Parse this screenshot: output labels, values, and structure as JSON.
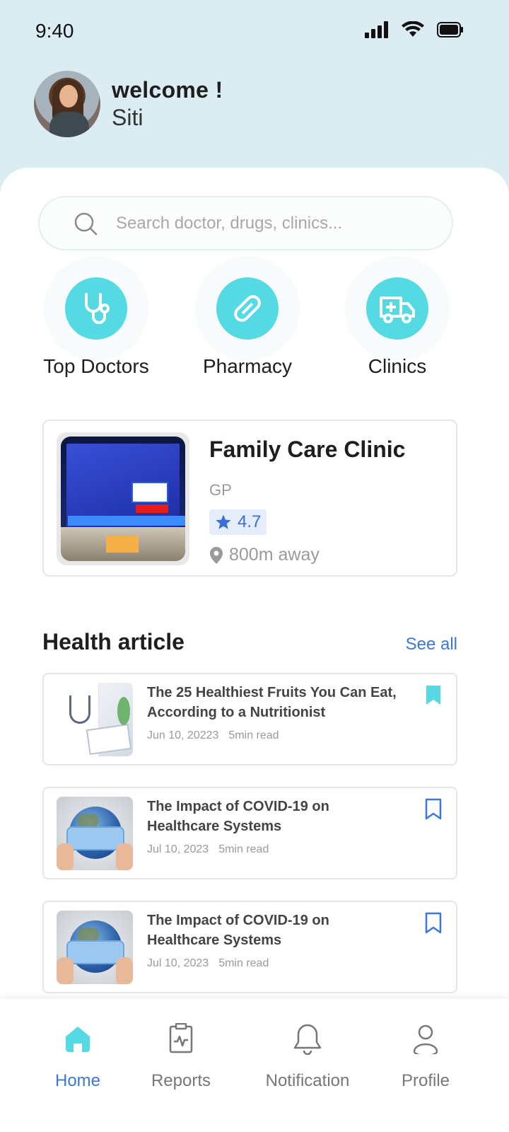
{
  "status": {
    "time": "9:40"
  },
  "user": {
    "greeting": "welcome !",
    "name": "Siti"
  },
  "search": {
    "placeholder": "Search doctor, drugs, clinics..."
  },
  "categories": [
    {
      "label": "Top Doctors",
      "icon": "stethoscope-icon"
    },
    {
      "label": "Pharmacy",
      "icon": "pill-icon"
    },
    {
      "label": "Clinics",
      "icon": "ambulance-icon"
    }
  ],
  "featured_clinic": {
    "name": "Family Care Clinic",
    "type": "GP",
    "rating": "4.7",
    "distance": "800m away"
  },
  "articles_section": {
    "title": "Health article",
    "see_all": "See all"
  },
  "articles": [
    {
      "title": "The 25 Healthiest Fruits You Can Eat, According to a Nutritionist",
      "date": "Jun 10, 20223",
      "read_time": "5min read",
      "bookmarked": true
    },
    {
      "title": "The Impact of COVID-19 on Healthcare Systems",
      "date": "Jul 10, 2023",
      "read_time": "5min read",
      "bookmarked": false
    },
    {
      "title": "The Impact of COVID-19 on Healthcare Systems",
      "date": "Jul 10, 2023",
      "read_time": "5min read",
      "bookmarked": false
    }
  ],
  "nav": [
    {
      "label": "Home",
      "active": true
    },
    {
      "label": "Reports",
      "active": false
    },
    {
      "label": "Notification",
      "active": false
    },
    {
      "label": "Profile",
      "active": false
    }
  ],
  "colors": {
    "accent": "#55d9e3",
    "link": "#3b78d8",
    "header_bg": "#dbecf3"
  }
}
